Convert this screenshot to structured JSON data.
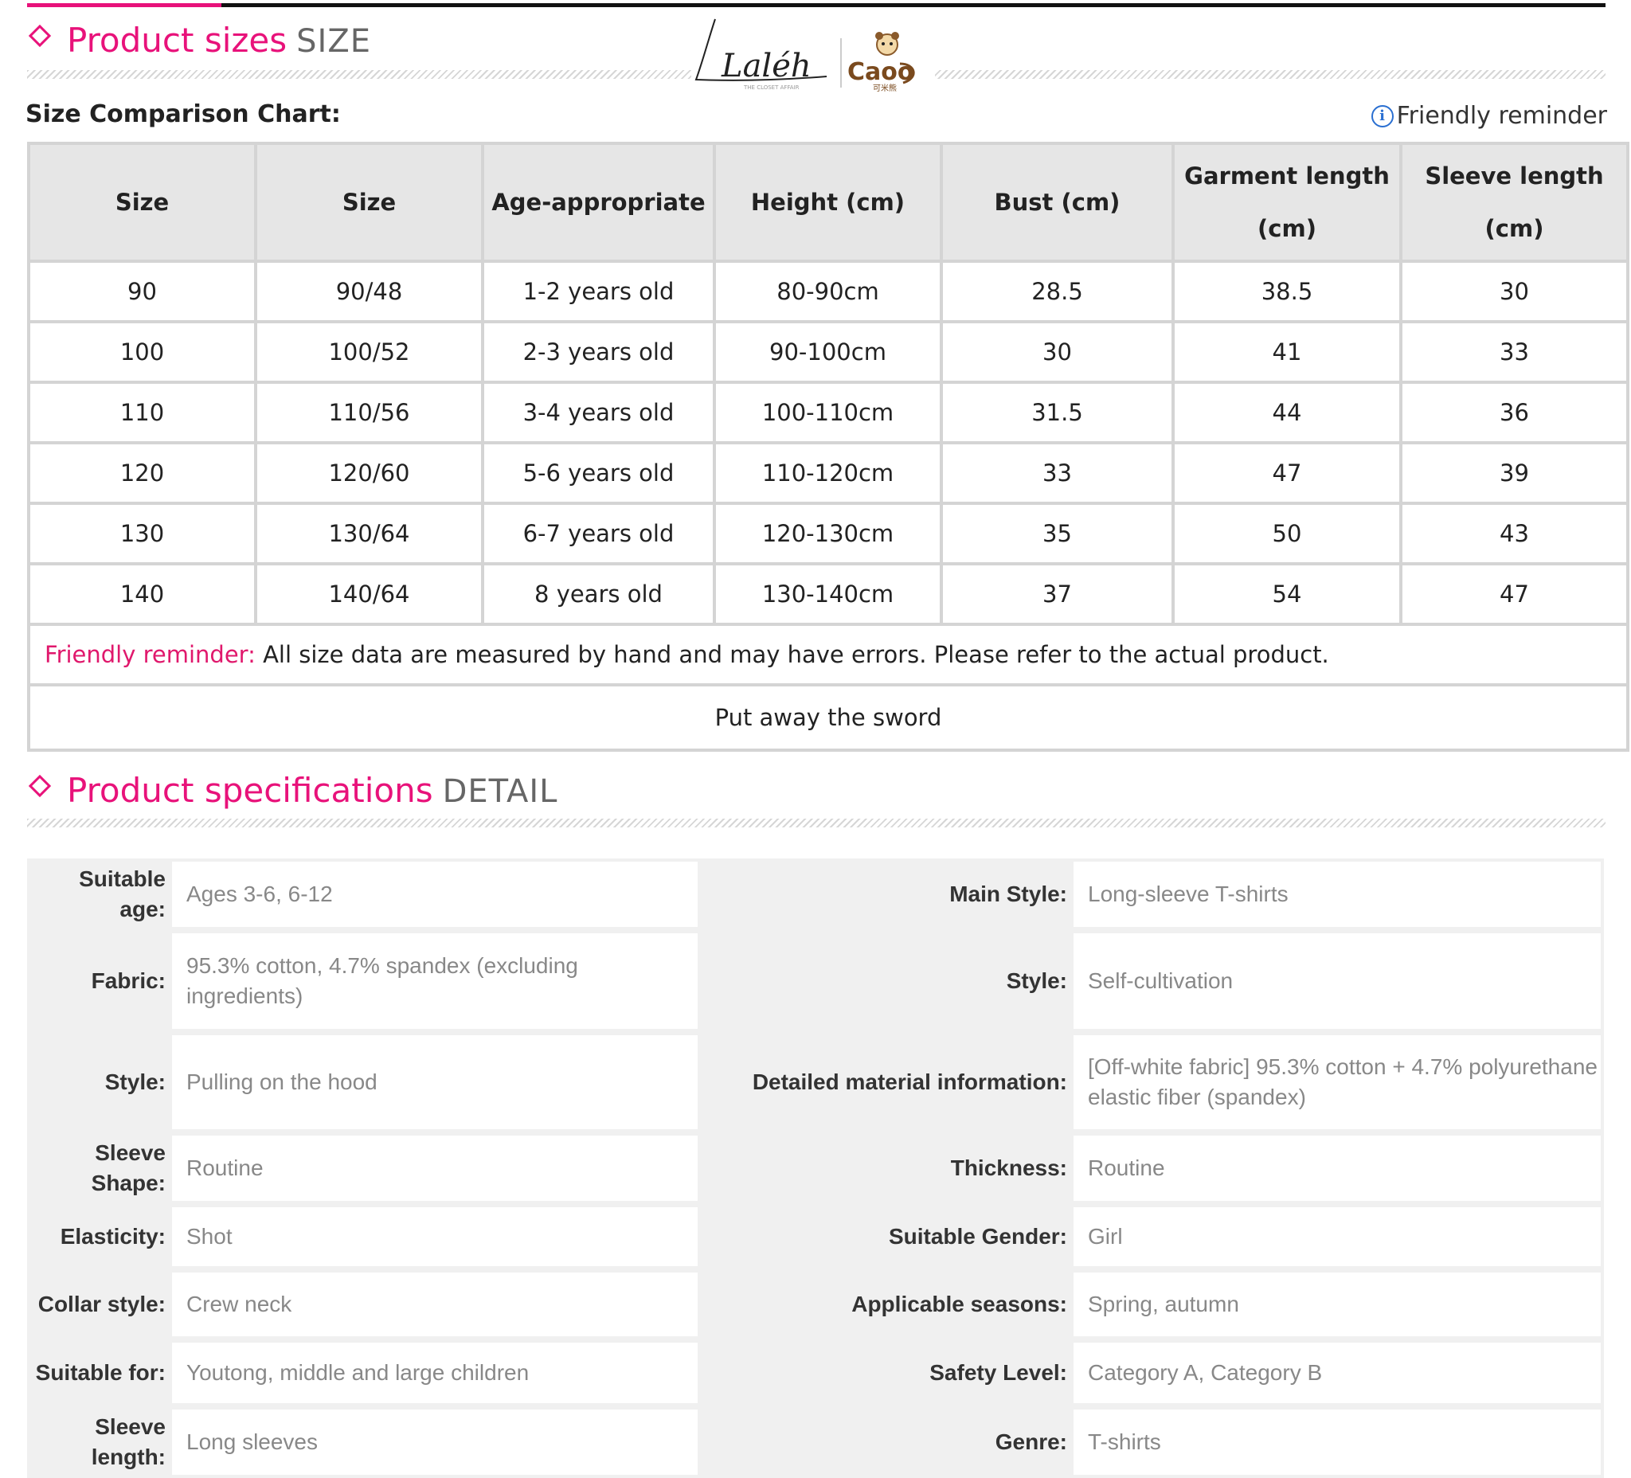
{
  "size_section": {
    "title": "Product sizes",
    "subtitle": "SIZE",
    "chart_label": "Size Comparison Chart:",
    "reminder_link": "Friendly reminder"
  },
  "logo": {
    "brand_left": "Laléh",
    "brand_left_tagline": "THE CLOSET AFFAIR",
    "brand_right": "Caoo",
    "brand_right_cn": "可米熊"
  },
  "size_table": {
    "headers": [
      "Size",
      "Size",
      "Age-appropriate",
      "Height (cm)",
      "Bust (cm)",
      "Garment length (cm)",
      "Sleeve length (cm)"
    ],
    "rows": [
      [
        "90",
        "90/48",
        "1-2 years old",
        "80-90cm",
        "28.5",
        "38.5",
        "30"
      ],
      [
        "100",
        "100/52",
        "2-3 years old",
        "90-100cm",
        "30",
        "41",
        "33"
      ],
      [
        "110",
        "110/56",
        "3-4 years old",
        "100-110cm",
        "31.5",
        "44",
        "36"
      ],
      [
        "120",
        "120/60",
        "5-6 years old",
        "110-120cm",
        "33",
        "47",
        "39"
      ],
      [
        "130",
        "130/64",
        "6-7 years old",
        "120-130cm",
        "35",
        "50",
        "43"
      ],
      [
        "140",
        "140/64",
        "8 years old",
        "130-140cm",
        "37",
        "54",
        "47"
      ]
    ],
    "note_key": "Friendly reminder:",
    "note_text": " All size data are measured by hand and may have errors. Please refer to the actual product.",
    "footer": "Put away the sword"
  },
  "spec_section": {
    "title": "Product specifications",
    "subtitle": "DETAIL"
  },
  "spec_table": {
    "rows": [
      {
        "k1": "Suitable age:",
        "v1": "Ages 3-6, 6-12",
        "k2": "Main Style:",
        "v2": "Long-sleeve T-shirts"
      },
      {
        "k1": "Fabric:",
        "v1": "95.3% cotton, 4.7% spandex (excluding ingredients)",
        "k2": "Style:",
        "v2": "Self-cultivation"
      },
      {
        "k1": "Style:",
        "v1": "Pulling on the hood",
        "k2": "Detailed material information:",
        "v2": "[Off-white fabric] 95.3% cotton + 4.7% polyurethane elastic fiber (spandex)"
      },
      {
        "k1": "Sleeve Shape:",
        "v1": "Routine",
        "k2": "Thickness:",
        "v2": "Routine"
      },
      {
        "k1": "Elasticity:",
        "v1": "Shot",
        "k2": "Suitable Gender:",
        "v2": "Girl"
      },
      {
        "k1": "Collar style:",
        "v1": "Crew neck",
        "k2": "Applicable seasons:",
        "v2": "Spring, autumn"
      },
      {
        "k1": "Suitable for:",
        "v1": "Youtong, middle and large children",
        "k2": "Safety Level:",
        "v2": "Category A, Category B"
      },
      {
        "k1": "Sleeve length:",
        "v1": "Long sleeves",
        "k2": "Genre:",
        "v2": "T-shirts"
      }
    ]
  }
}
